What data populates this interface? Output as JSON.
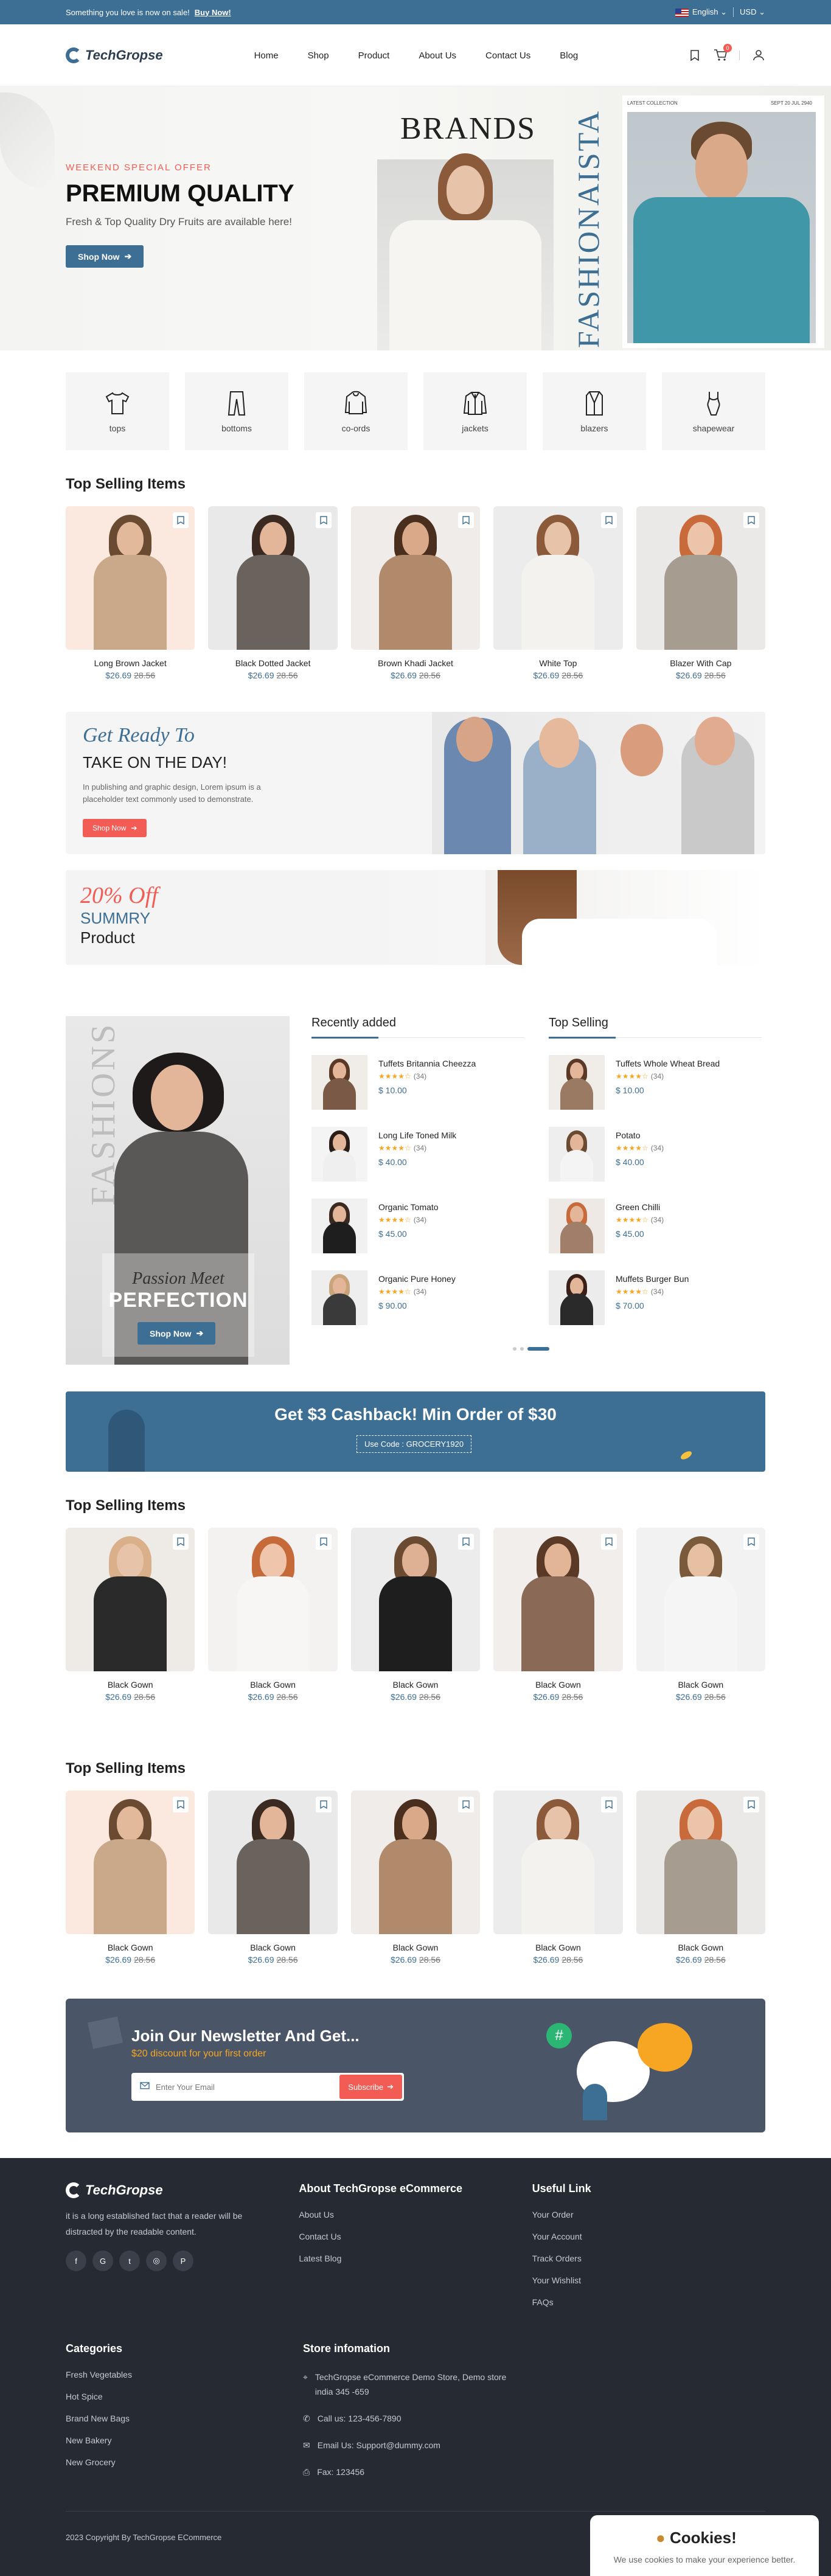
{
  "topbar": {
    "promo": "Something you love is now on sale!",
    "promo_link": "Buy Now!",
    "language": "English",
    "currency": "USD"
  },
  "header": {
    "logo": "TechGropse",
    "nav": [
      "Home",
      "Shop",
      "Product",
      "About Us",
      "Contact Us",
      "Blog"
    ],
    "cart_count": "0"
  },
  "hero": {
    "kicker": "WEEKEND SPECIAL OFFER",
    "title": "PREMIUM QUALITY",
    "subtitle": "Fresh & Top Quality Dry Fruits are available here!",
    "button": "Shop Now",
    "brands": "BRANDS",
    "fashion": "FASHIONAISTA",
    "card_left": "LATEST COLLECTION",
    "card_right": "SEPT 20 JUL 2940"
  },
  "categories": [
    "tops",
    "bottoms",
    "co-ords",
    "jackets",
    "blazers",
    "shapewear"
  ],
  "top_selling_1": {
    "title": "Top Selling Items",
    "items": [
      {
        "name": "Long Brown Jacket",
        "price": "$26.69",
        "old": "28.56"
      },
      {
        "name": "Black Dotted Jacket",
        "price": "$26.69",
        "old": "28.56"
      },
      {
        "name": "Brown Khadi Jacket",
        "price": "$26.69",
        "old": "28.56"
      },
      {
        "name": "White Top",
        "price": "$26.69",
        "old": "28.56"
      },
      {
        "name": "Blazer With Cap",
        "price": "$26.69",
        "old": "28.56"
      }
    ]
  },
  "banner1": {
    "script": "Get Ready To",
    "title": "TAKE ON THE DAY!",
    "text": "In publishing and graphic design, Lorem ipsum is a placeholder text commonly used to demonstrate.",
    "button": "Shop Now"
  },
  "banner2": {
    "off": "20% Off",
    "line1": "SUMMRY",
    "line2": "Product"
  },
  "poster": {
    "vertical": "FASHIONS",
    "script": "Passion Meet",
    "title": "PERFECTION",
    "button": "Shop Now"
  },
  "recently_added": {
    "title": "Recently added",
    "items": [
      {
        "name": "Tuffets Britannia Cheezza",
        "reviews": "(34)",
        "price": "$ 10.00"
      },
      {
        "name": "Long Life Toned Milk",
        "reviews": "(34)",
        "price": "$ 40.00"
      },
      {
        "name": "Organic Tomato",
        "reviews": "(34)",
        "price": "$ 45.00"
      },
      {
        "name": "Organic Pure Honey",
        "reviews": "(34)",
        "price": "$ 90.00"
      }
    ]
  },
  "top_selling_list": {
    "title": "Top Selling",
    "items": [
      {
        "name": "Tuffets Whole Wheat Bread",
        "reviews": "(34)",
        "price": "$ 10.00"
      },
      {
        "name": "Potato",
        "reviews": "(34)",
        "price": "$ 40.00"
      },
      {
        "name": "Green Chilli",
        "reviews": "(34)",
        "price": "$ 45.00"
      },
      {
        "name": "Muffets Burger Bun",
        "reviews": "(34)",
        "price": "$ 70.00"
      }
    ]
  },
  "cashback": {
    "title": "Get $3 Cashback! Min Order of $30",
    "code": "Use Code : GROCERY1920"
  },
  "top_selling_2": {
    "title": "Top Selling Items",
    "items": [
      {
        "name": "Black Gown",
        "price": "$26.69",
        "old": "28.56"
      },
      {
        "name": "Black Gown",
        "price": "$26.69",
        "old": "28.56"
      },
      {
        "name": "Black Gown",
        "price": "$26.69",
        "old": "28.56"
      },
      {
        "name": "Black Gown",
        "price": "$26.69",
        "old": "28.56"
      },
      {
        "name": "Black Gown",
        "price": "$26.69",
        "old": "28.56"
      }
    ]
  },
  "top_selling_3": {
    "title": "Top Selling Items",
    "items": [
      {
        "name": "Black Gown",
        "price": "$26.69",
        "old": "28.56"
      },
      {
        "name": "Black Gown",
        "price": "$26.69",
        "old": "28.56"
      },
      {
        "name": "Black Gown",
        "price": "$26.69",
        "old": "28.56"
      },
      {
        "name": "Black Gown",
        "price": "$26.69",
        "old": "28.56"
      },
      {
        "name": "Black Gown",
        "price": "$26.69",
        "old": "28.56"
      }
    ]
  },
  "newsletter": {
    "title": "Join Our Newsletter And Get...",
    "subtitle": "$20 discount for your first order",
    "placeholder": "Enter Your Email",
    "button": "Subscribe"
  },
  "footer": {
    "about": "it is a long established fact that a reader will be distracted by the readable content.",
    "social": [
      "f",
      "G",
      "t",
      "◎",
      "P"
    ],
    "about_title": "About TechGropse eCommerce",
    "about_links": [
      "About Us",
      "Contact Us",
      "Latest Blog"
    ],
    "useful_title": "Useful Link",
    "useful_links": [
      "Your Order",
      "Your Account",
      "Track Orders",
      "Your Wishlist",
      "FAQs"
    ],
    "categories_title": "Categories",
    "categories": [
      "Fresh Vegetables",
      "Hot Spice",
      "Brand New Bags",
      "New Bakery",
      "New Grocery"
    ],
    "store_title": "Store infomation",
    "store_address": "TechGropse eCommerce Demo Store, Demo store india 345 -659",
    "store_phone": "Call us: 123-456-7890",
    "store_email": "Email Us: Support@dummy.com",
    "store_fax": "Fax: 123456",
    "copyright": "2023 Copyright By TechGropse ECommerce"
  },
  "cookie": {
    "title": "Cookies!",
    "text": "We use cookies to make your experience better."
  },
  "colors": {
    "primary": "#3d6e94",
    "accent": "#f25c54",
    "star": "#f6a623",
    "footer": "#262a33"
  }
}
